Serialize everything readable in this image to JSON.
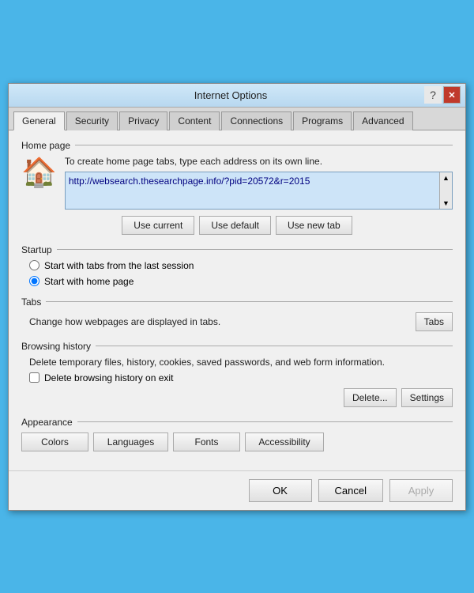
{
  "window": {
    "title": "Internet Options",
    "help_icon": "?",
    "close_icon": "✕"
  },
  "tabs": [
    {
      "label": "General",
      "active": true
    },
    {
      "label": "Security",
      "active": false
    },
    {
      "label": "Privacy",
      "active": false
    },
    {
      "label": "Content",
      "active": false
    },
    {
      "label": "Connections",
      "active": false
    },
    {
      "label": "Programs",
      "active": false
    },
    {
      "label": "Advanced",
      "active": false
    }
  ],
  "home_page": {
    "section_title": "Home page",
    "description": "To create home page tabs, type each address on its own line.",
    "url_value": "http://websearch.thesearchpage.info/?pid=20572&r=2015",
    "btn_use_current": "Use current",
    "btn_use_default": "Use default",
    "btn_use_new_tab": "Use new tab"
  },
  "startup": {
    "section_title": "Startup",
    "option1": "Start with tabs from the last session",
    "option2": "Start with home page",
    "selected": 2
  },
  "tabs_section": {
    "section_title": "Tabs",
    "description": "Change how webpages are displayed in tabs.",
    "btn_label": "Tabs"
  },
  "browsing_history": {
    "section_title": "Browsing history",
    "description": "Delete temporary files, history, cookies, saved passwords, and web form information.",
    "checkbox_label": "Delete browsing history on exit",
    "checkbox_checked": false,
    "btn_delete": "Delete...",
    "btn_settings": "Settings"
  },
  "appearance": {
    "section_title": "Appearance",
    "btn_colors": "Colors",
    "btn_languages": "Languages",
    "btn_fonts": "Fonts",
    "btn_accessibility": "Accessibility"
  },
  "bottom_buttons": {
    "ok": "OK",
    "cancel": "Cancel",
    "apply": "Apply"
  }
}
